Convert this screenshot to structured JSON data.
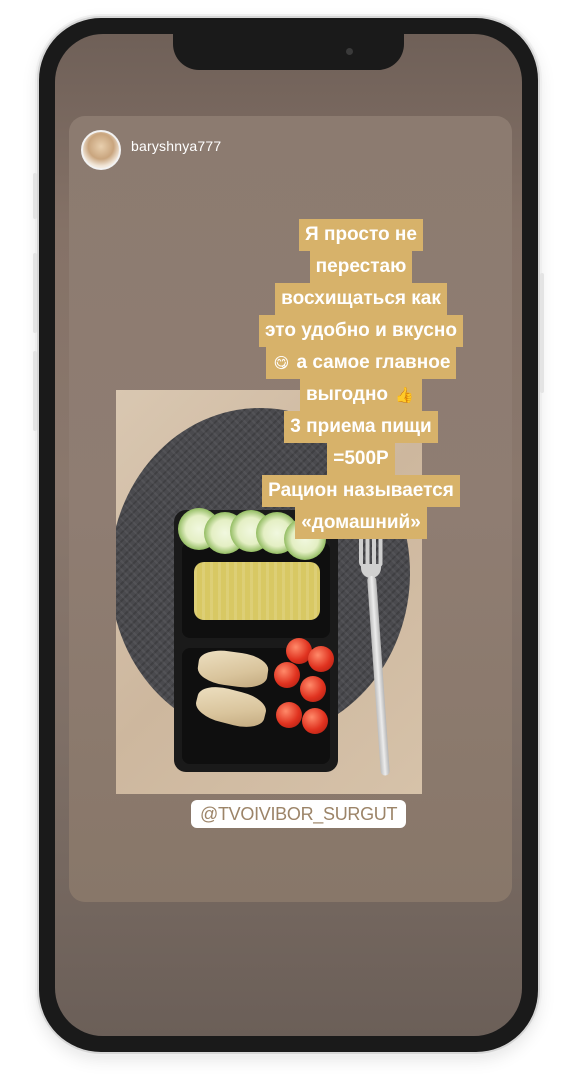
{
  "story": {
    "username": "baryshnya777",
    "caption_lines": [
      "Я просто не",
      "перестаю",
      "восхищаться как",
      "это удобно и вкусно",
      "а самое главное",
      "выгодно",
      "3 приема пищи",
      "=500Р",
      "Рацион называется",
      "«домашний»"
    ],
    "emoji_yum": "😋",
    "emoji_thumb": "👍",
    "mention": "@TVOIVIBOR_SURGUT"
  },
  "icons": {
    "avatar": "profile-avatar",
    "photo": "food-container-photo"
  },
  "colors": {
    "caption_highlight": "#d7b26a",
    "mention_text": "#9c8468",
    "screen_bg": "#857267"
  }
}
